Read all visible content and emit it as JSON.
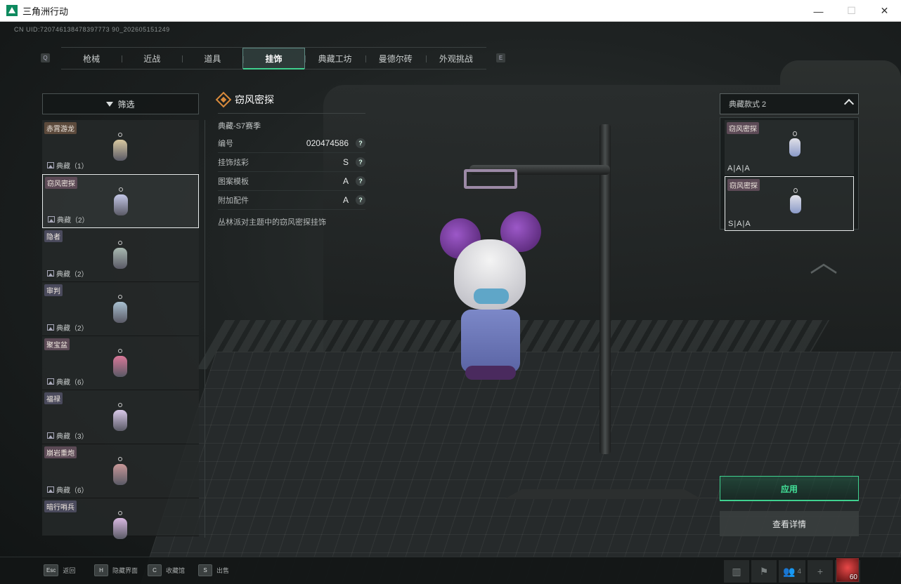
{
  "window": {
    "title": "三角洲行动",
    "minimize": "—",
    "maximize": "☐",
    "close": "✕"
  },
  "uid": "CN UID:720746138478397773 90_202605151249",
  "tabs": {
    "left_key": "Q",
    "right_key": "E",
    "items": [
      {
        "label": "枪械",
        "active": false
      },
      {
        "label": "近战",
        "active": false
      },
      {
        "label": "道具",
        "active": false
      },
      {
        "label": "挂饰",
        "active": true
      },
      {
        "label": "典藏工坊",
        "active": false
      },
      {
        "label": "曼德尔砖",
        "active": false
      },
      {
        "label": "外观挑战",
        "active": false
      }
    ]
  },
  "filter": {
    "label": "筛选",
    "icon": "filter-icon"
  },
  "items": [
    {
      "name": "赤霄游龙",
      "count": "典藏（1）",
      "name_bg": "#5c4a3c",
      "color": "#d8c8a0",
      "selected": false
    },
    {
      "name": "窃风密探",
      "count": "典藏（2）",
      "name_bg": "#5c4a56",
      "color": "#c4c8e8",
      "selected": true
    },
    {
      "name": "隐者",
      "count": "典藏（2）",
      "name_bg": "#4a4a5c",
      "color": "#a8b8b0",
      "selected": false
    },
    {
      "name": "审判",
      "count": "典藏（2）",
      "name_bg": "#4a4a5c",
      "color": "#a8c0d0",
      "selected": false
    },
    {
      "name": "聚宝盆",
      "count": "典藏（6）",
      "name_bg": "#5c4a56",
      "color": "#d87898",
      "selected": false
    },
    {
      "name": "福禄",
      "count": "典藏（3）",
      "name_bg": "#4a4a5c",
      "color": "#d8c8e8",
      "selected": false
    },
    {
      "name": "崩岩重炮",
      "count": "典藏（6）",
      "name_bg": "#5c4a56",
      "color": "#c89898",
      "selected": false
    },
    {
      "name": "暗行哨兵",
      "count": "",
      "name_bg": "#4a4a5c",
      "color": "#d8b8e0",
      "selected": false
    }
  ],
  "detail": {
    "title": "窃风密探",
    "season": "典藏-S7赛季",
    "rows": [
      {
        "key": "编号",
        "value": "020474586"
      },
      {
        "key": "挂饰炫彩",
        "value": "S"
      },
      {
        "key": "图案模板",
        "value": "A"
      },
      {
        "key": "附加配件",
        "value": "A"
      }
    ],
    "help": "?",
    "description": "丛林派对主题中的窃风密探挂饰"
  },
  "variants": {
    "select_label": "典藏款式 2",
    "items": [
      {
        "name": "窃风密探",
        "grade": "A|A|A",
        "selected": false
      },
      {
        "name": "窃风密探",
        "grade": "S|A|A",
        "selected": true
      }
    ]
  },
  "buttons": {
    "apply": "应用",
    "view_details": "查看详情"
  },
  "bottom_hints": [
    {
      "key": "Esc",
      "label": "返回"
    },
    {
      "key": "H",
      "label": "隐藏界面"
    },
    {
      "key": "C",
      "label": "收藏馆"
    },
    {
      "key": "S",
      "label": "出售"
    }
  ],
  "bottom_right": {
    "stats_icon": "bar-chart-icon",
    "flag_icon": "flag-icon",
    "team_count": "4",
    "add1": "+",
    "add2": "+",
    "level": "60"
  }
}
